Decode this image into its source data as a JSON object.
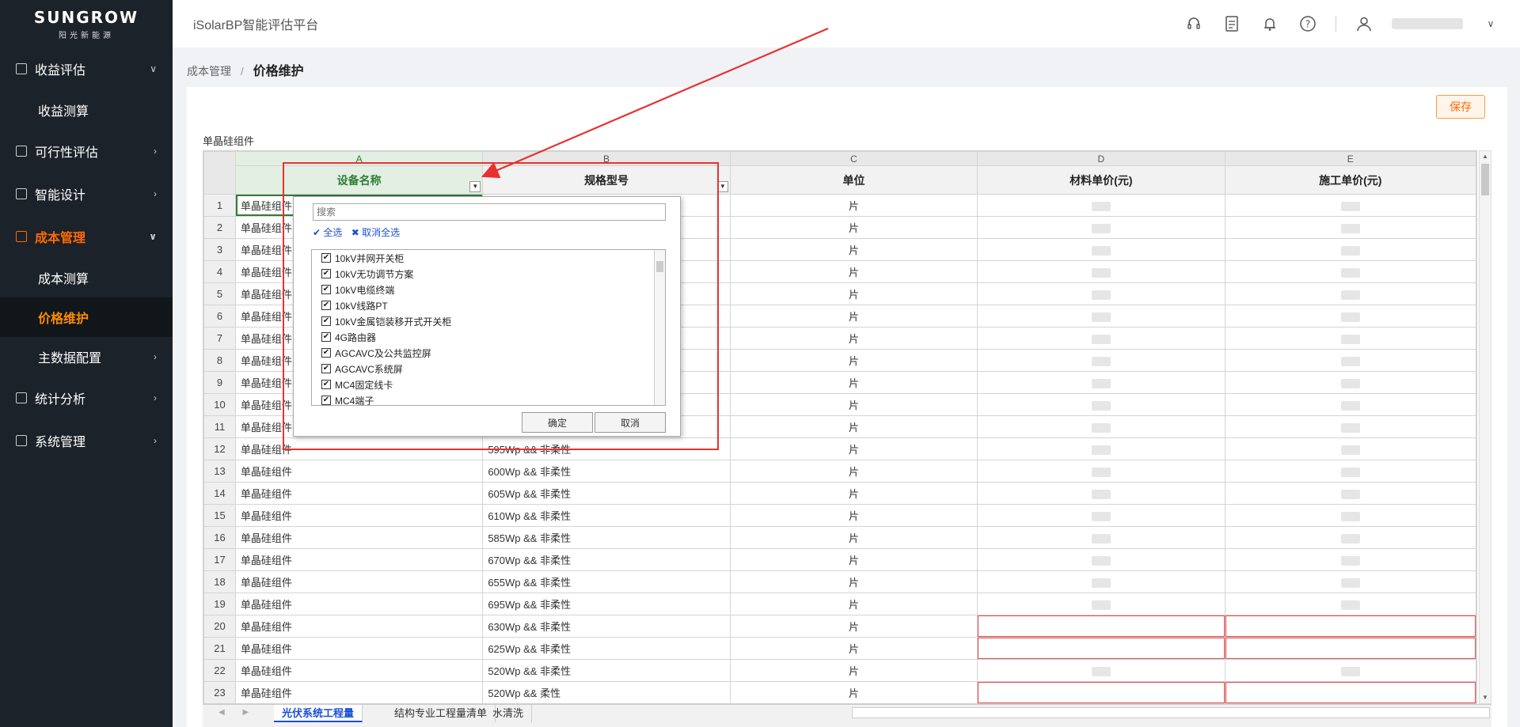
{
  "logo": {
    "brand": "SUNGROW",
    "sub": "阳光新能源"
  },
  "header": {
    "title": "iSolarBP智能评估平台"
  },
  "sidebar": {
    "items": [
      {
        "label": "收益评估",
        "chev": "∨",
        "expanded": true
      },
      {
        "label": "收益测算",
        "sub": true
      },
      {
        "label": "可行性评估",
        "chev": "›"
      },
      {
        "label": "智能设计",
        "chev": "›"
      },
      {
        "label": "成本管理",
        "chev": "∨",
        "active": true
      },
      {
        "label": "成本测算",
        "sub": true
      },
      {
        "label": "价格维护",
        "sub": true,
        "selected": true
      },
      {
        "label": "主数据配置",
        "sub": true,
        "chev": "›"
      },
      {
        "label": "统计分析",
        "chev": "›"
      },
      {
        "label": "系统管理",
        "chev": "›"
      }
    ]
  },
  "breadcrumb": {
    "parent": "成本管理",
    "sep": "/",
    "current": "价格维护"
  },
  "toolbar": {
    "save_label": "保存"
  },
  "sheet": {
    "label": "单晶硅组件",
    "col_letters": [
      "A",
      "B",
      "C",
      "D",
      "E"
    ],
    "col_heads": [
      "设备名称",
      "规格型号",
      "单位",
      "材料单价(元)",
      "施工单价(元)"
    ],
    "rows": [
      {
        "n": "1",
        "a": "单晶硅组件",
        "b": "",
        "c": "片"
      },
      {
        "n": "2",
        "a": "单晶硅组件",
        "b": "",
        "c": "片"
      },
      {
        "n": "3",
        "a": "单晶硅组件",
        "b": "",
        "c": "片"
      },
      {
        "n": "4",
        "a": "单晶硅组件",
        "b": "",
        "c": "片"
      },
      {
        "n": "5",
        "a": "单晶硅组件",
        "b": "",
        "c": "片"
      },
      {
        "n": "6",
        "a": "单晶硅组件",
        "b": "",
        "c": "片"
      },
      {
        "n": "7",
        "a": "单晶硅组件",
        "b": "",
        "c": "片"
      },
      {
        "n": "8",
        "a": "单晶硅组件",
        "b": "",
        "c": "片"
      },
      {
        "n": "9",
        "a": "单晶硅组件",
        "b": "",
        "c": "片"
      },
      {
        "n": "10",
        "a": "单晶硅组件",
        "b": "",
        "c": "片"
      },
      {
        "n": "11",
        "a": "单晶硅组件",
        "b": "",
        "c": "片"
      },
      {
        "n": "12",
        "a": "单晶硅组件",
        "b": "595Wp && 非柔性",
        "c": "片"
      },
      {
        "n": "13",
        "a": "单晶硅组件",
        "b": "600Wp && 非柔性",
        "c": "片"
      },
      {
        "n": "14",
        "a": "单晶硅组件",
        "b": "605Wp && 非柔性",
        "c": "片"
      },
      {
        "n": "15",
        "a": "单晶硅组件",
        "b": "610Wp && 非柔性",
        "c": "片"
      },
      {
        "n": "16",
        "a": "单晶硅组件",
        "b": "585Wp && 非柔性",
        "c": "片"
      },
      {
        "n": "17",
        "a": "单晶硅组件",
        "b": "670Wp && 非柔性",
        "c": "片"
      },
      {
        "n": "18",
        "a": "单晶硅组件",
        "b": "655Wp && 非柔性",
        "c": "片"
      },
      {
        "n": "19",
        "a": "单晶硅组件",
        "b": "695Wp && 非柔性",
        "c": "片"
      },
      {
        "n": "20",
        "a": "单晶硅组件",
        "b": "630Wp && 非柔性",
        "c": "片",
        "err": true
      },
      {
        "n": "21",
        "a": "单晶硅组件",
        "b": "625Wp && 非柔性",
        "c": "片",
        "err": true
      },
      {
        "n": "22",
        "a": "单晶硅组件",
        "b": "520Wp && 非柔性",
        "c": "片"
      },
      {
        "n": "23",
        "a": "单晶硅组件",
        "b": "520Wp && 柔性",
        "c": "片",
        "err": true
      }
    ]
  },
  "tabs": [
    "光伏系统工程量",
    "结构专业工程量清单",
    "水清洗"
  ],
  "filter": {
    "search_placeholder": "搜索",
    "select_all": "✔ 全选",
    "clear_all": "✖ 取消全选",
    "options": [
      "10kV并网开关柜",
      "10kV无功调节方案",
      "10kV电缆终端",
      "10kV线路PT",
      "10kV金属铠装移开式开关柜",
      "4G路由器",
      "AGCAVC及公共监控屏",
      "AGCAVC系统屏",
      "MC4固定线卡",
      "MC4端子"
    ],
    "ok": "确定",
    "cancel": "取消"
  },
  "colors": {
    "accent": "#ff6a00",
    "sidebar_bg": "#1c2229",
    "annotation": "#e8322e"
  }
}
